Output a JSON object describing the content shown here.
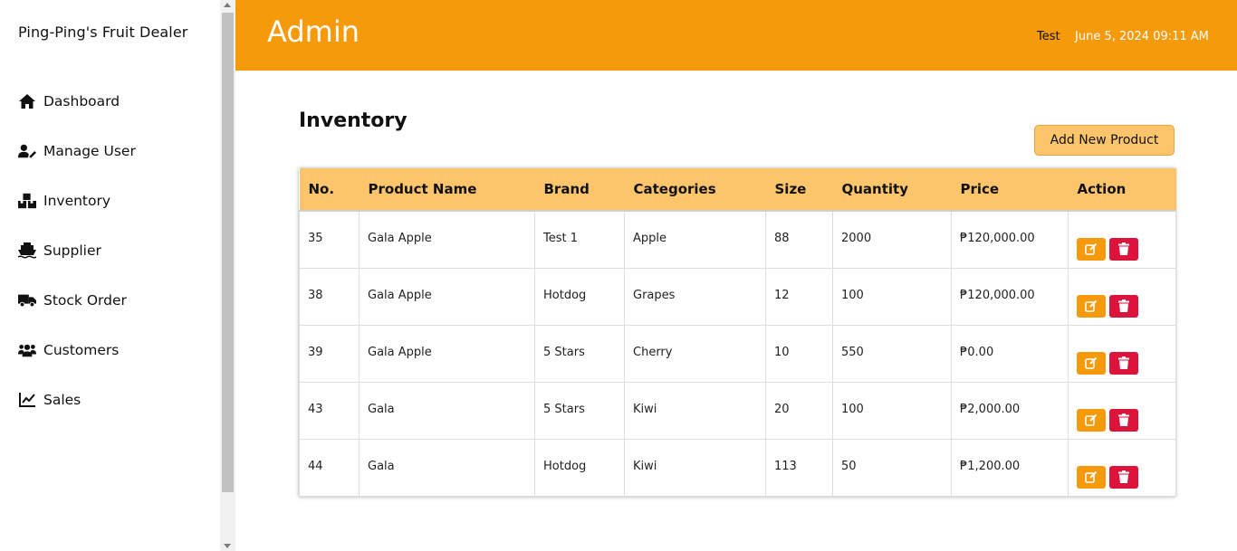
{
  "sidebar": {
    "brand": "Ping-Ping's Fruit Dealer",
    "items": [
      {
        "label": "Dashboard",
        "icon": "house-icon"
      },
      {
        "label": "Manage User",
        "icon": "user-pen-icon"
      },
      {
        "label": "Inventory",
        "icon": "boxes-icon"
      },
      {
        "label": "Supplier",
        "icon": "ship-icon"
      },
      {
        "label": "Stock Order",
        "icon": "truck-icon"
      },
      {
        "label": "Customers",
        "icon": "users-icon"
      },
      {
        "label": "Sales",
        "icon": "line-chart-icon"
      }
    ]
  },
  "header": {
    "title": "Admin",
    "user": "Test",
    "datetime": "June 5, 2024 09:11 AM",
    "color": "#f59a0a"
  },
  "main": {
    "title": "Inventory",
    "add_button": "Add New Product"
  },
  "table": {
    "columns": [
      "No.",
      "Product Name",
      "Brand",
      "Categories",
      "Size",
      "Quantity",
      "Price",
      "Action"
    ],
    "rows": [
      {
        "no": "35",
        "name": "Gala Apple",
        "brand": "Test 1",
        "category": "Apple",
        "size": "88",
        "quantity": "2000",
        "price": "₱120,000.00"
      },
      {
        "no": "38",
        "name": "Gala Apple",
        "brand": "Hotdog",
        "category": "Grapes",
        "size": "12",
        "quantity": "100",
        "price": "₱120,000.00"
      },
      {
        "no": "39",
        "name": "Gala Apple",
        "brand": "5 Stars",
        "category": "Cherry",
        "size": "10",
        "quantity": "550",
        "price": "₱0.00"
      },
      {
        "no": "43",
        "name": "Gala",
        "brand": "5 Stars",
        "category": "Kiwi",
        "size": "20",
        "quantity": "100",
        "price": "₱2,000.00"
      },
      {
        "no": "44",
        "name": "Gala",
        "brand": "Hotdog",
        "category": "Kiwi",
        "size": "113",
        "quantity": "50",
        "price": "₱1,200.00"
      }
    ]
  },
  "colors": {
    "accent": "#f59a0a",
    "header_row": "#fdc56b",
    "delete": "#dc143c"
  }
}
